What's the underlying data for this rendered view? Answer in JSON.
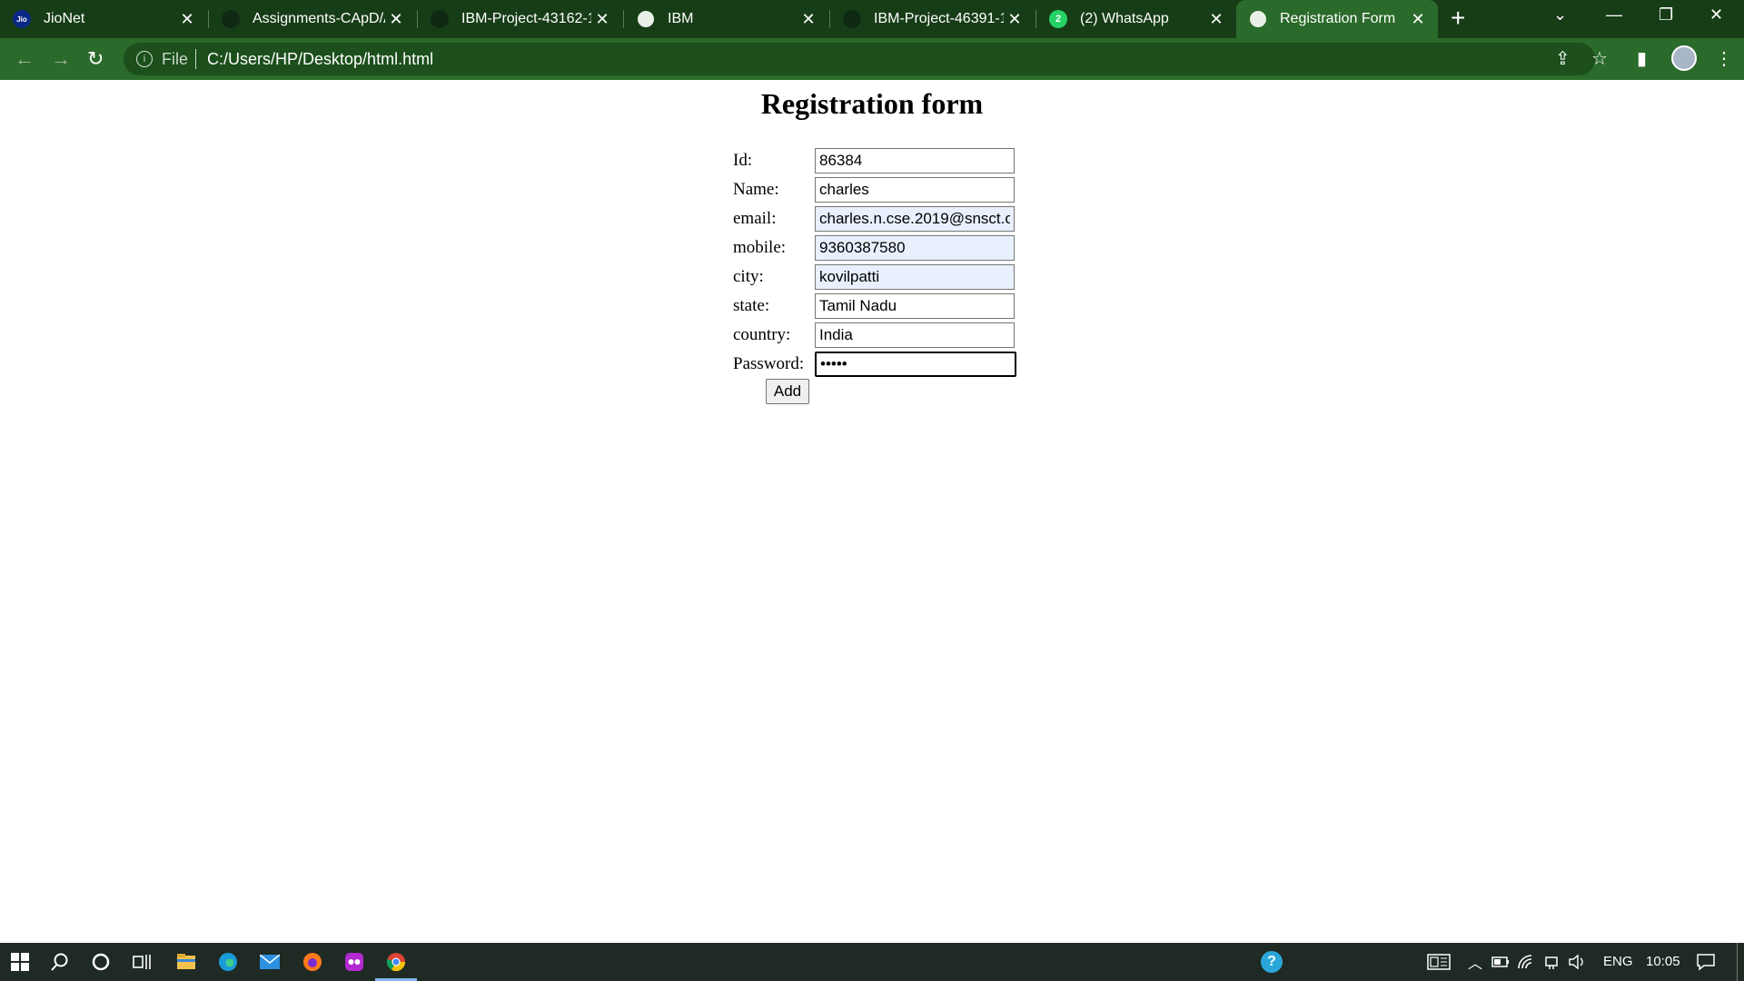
{
  "browser": {
    "tabs": [
      {
        "title": "JioNet",
        "favicon": "jio-icon",
        "active": false
      },
      {
        "title": "Assignments-CApD/A",
        "favicon": "github-icon",
        "active": false
      },
      {
        "title": "IBM-Project-43162-1(",
        "favicon": "github-icon",
        "active": false
      },
      {
        "title": "IBM",
        "favicon": "globe-icon",
        "active": false
      },
      {
        "title": "IBM-Project-46391-1(",
        "favicon": "github-icon",
        "active": false
      },
      {
        "title": "(2) WhatsApp",
        "favicon": "whatsapp-icon",
        "active": false
      },
      {
        "title": "Registration Form",
        "favicon": "globe-icon",
        "active": true
      }
    ],
    "whatsapp_badge": "2",
    "jio_favicon_text": "Jio",
    "address": {
      "scheme_label": "File",
      "url": "C:/Users/HP/Desktop/html.html"
    },
    "colors": {
      "theme": "#2a6a2a",
      "tabbar": "#173d17"
    }
  },
  "page": {
    "title": "Registration form",
    "fields": [
      {
        "label": "Id:",
        "value": "86384"
      },
      {
        "label": "Name:",
        "value": "charles"
      },
      {
        "label": "email:",
        "value": "charles.n.cse.2019@snsct.o"
      },
      {
        "label": "mobile:",
        "value": "9360387580"
      },
      {
        "label": "city:",
        "value": "kovilpatti"
      },
      {
        "label": "state:",
        "value": "Tamil Nadu"
      },
      {
        "label": "country:",
        "value": "India"
      },
      {
        "label": "Password:",
        "value": "•••••"
      }
    ],
    "submit_label": "Add"
  },
  "taskbar": {
    "language": "ENG",
    "time": "10:05",
    "help_badge": "?"
  }
}
